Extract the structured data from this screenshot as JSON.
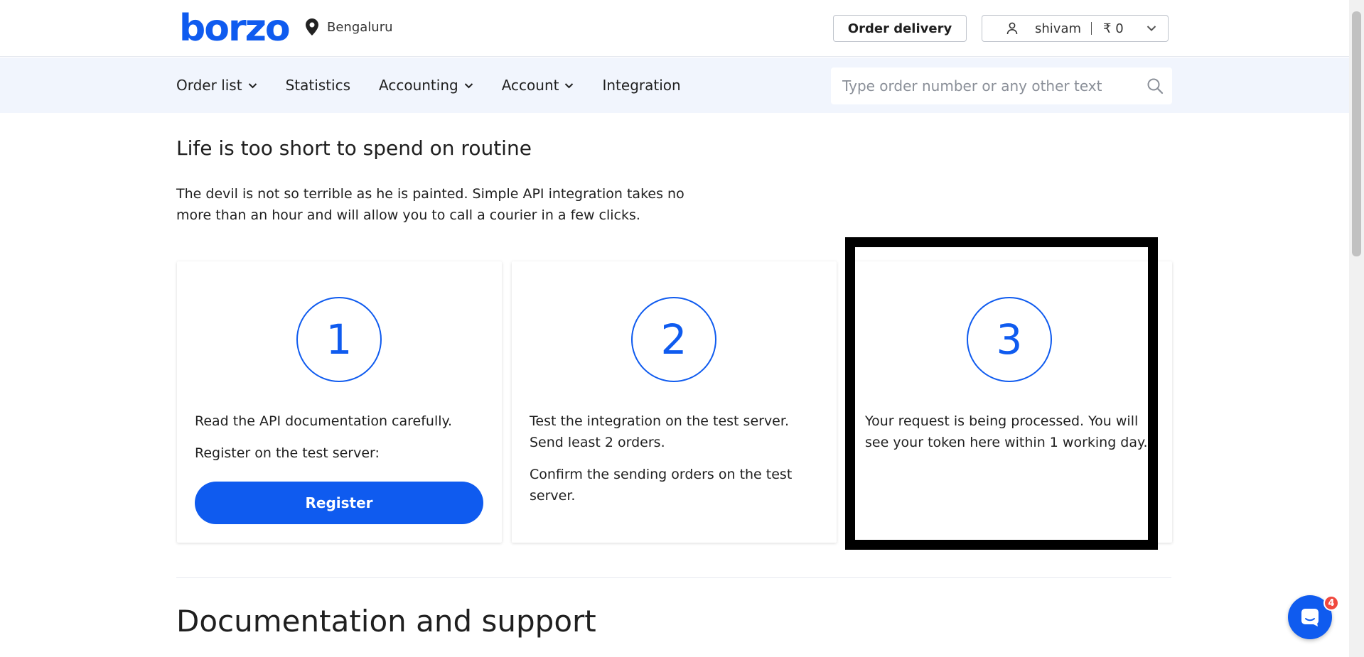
{
  "header": {
    "logo": "borzo",
    "city": "Bengaluru",
    "order_button": "Order delivery",
    "user": {
      "name": "shivam",
      "balance": "₹ 0"
    }
  },
  "nav": {
    "items": [
      {
        "label": "Order list",
        "has_dropdown": true
      },
      {
        "label": "Statistics",
        "has_dropdown": false
      },
      {
        "label": "Accounting",
        "has_dropdown": true
      },
      {
        "label": "Account",
        "has_dropdown": true
      },
      {
        "label": "Integration",
        "has_dropdown": false
      }
    ],
    "search": {
      "placeholder": "Type order number or any other text",
      "value": ""
    }
  },
  "main": {
    "headline": "Life is too short to spend on routine",
    "intro": "The devil is not so terrible as he is painted. Simple API integration takes no more than an hour and will allow you to call a courier in a few clicks.",
    "steps": [
      {
        "number": "1",
        "text1": "Read the API documentation carefully.",
        "text2": "Register on the test server:",
        "button": "Register"
      },
      {
        "number": "2",
        "text1": "Test the integration on the test server. Send least 2 orders.",
        "text2": "Confirm the sending orders on the test server."
      },
      {
        "number": "3",
        "text1": "Your request is being processed. You will see your token here within 1 working day."
      }
    ],
    "docs_heading": "Documentation and support"
  },
  "chat": {
    "badge": "4"
  },
  "colors": {
    "brand": "#0f5bef",
    "nav_bg": "#f1f5fd",
    "badge": "#f0483e"
  }
}
